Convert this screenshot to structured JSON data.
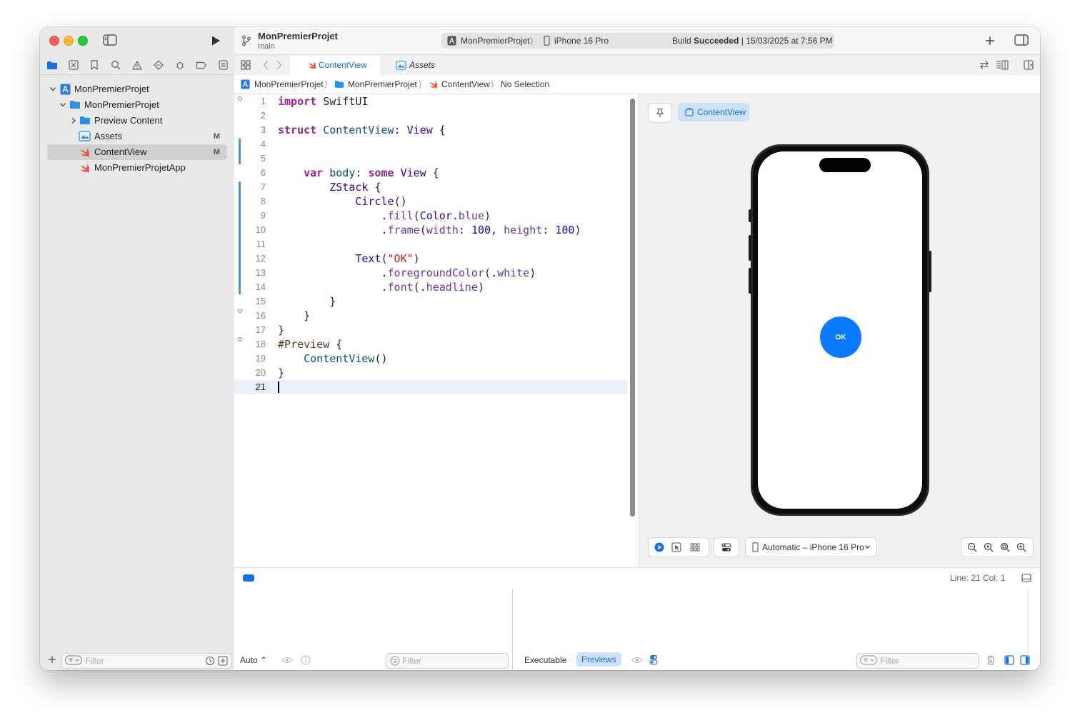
{
  "window": {
    "project_name": "MonPremierProjet",
    "branch": "main",
    "scheme": "MonPremierProjet",
    "destination": "iPhone 16 Pro",
    "build_status_prefix": "Build ",
    "build_status_bold": "Succeeded",
    "build_status_suffix": " | 15/03/2025 at 7:56 PM"
  },
  "navigator": {
    "items": [
      {
        "label": "MonPremierProjet",
        "icon": "project-icon",
        "badge": ""
      },
      {
        "label": "MonPremierProjet",
        "icon": "folder-icon",
        "badge": ""
      },
      {
        "label": "Preview Content",
        "icon": "folder-icon",
        "badge": ""
      },
      {
        "label": "Assets",
        "icon": "assets-icon",
        "badge": "M"
      },
      {
        "label": "ContentView",
        "icon": "swift-icon",
        "badge": "M"
      },
      {
        "label": "MonPremierProjetApp",
        "icon": "swift-icon",
        "badge": ""
      }
    ],
    "filter_placeholder": "Filter"
  },
  "tabs": [
    {
      "label": "ContentView",
      "active": true
    },
    {
      "label": "Assets",
      "active": false
    }
  ],
  "jumpbar": {
    "items": [
      "MonPremierProjet",
      "MonPremierProjet",
      "ContentView",
      "No Selection"
    ]
  },
  "editor": {
    "line_numbers": [
      "1",
      "2",
      "3",
      "4",
      "5",
      "6",
      "7",
      "8",
      "9",
      "10",
      "11",
      "12",
      "13",
      "14",
      "15",
      "16",
      "17",
      "18",
      "19",
      "20",
      "21"
    ],
    "current_line": 21
  },
  "preview": {
    "chip_label": "ContentView",
    "circle_text": "OK",
    "circle_color": "#0a7aff",
    "device_menu": "Automatic – iPhone 16 Pro"
  },
  "status": {
    "position": "Line: 21  Col: 1"
  },
  "debug": {
    "auto_label": "Auto",
    "left_filter": "Filter",
    "executable_label": "Executable",
    "previews_label": "Previews",
    "right_filter": "Filter"
  },
  "colors": {
    "accent": "#1a6fe0",
    "keyword": "#9b2393",
    "type": "#0b4f79",
    "string": "#c41a16",
    "number": "#1c00cf"
  }
}
